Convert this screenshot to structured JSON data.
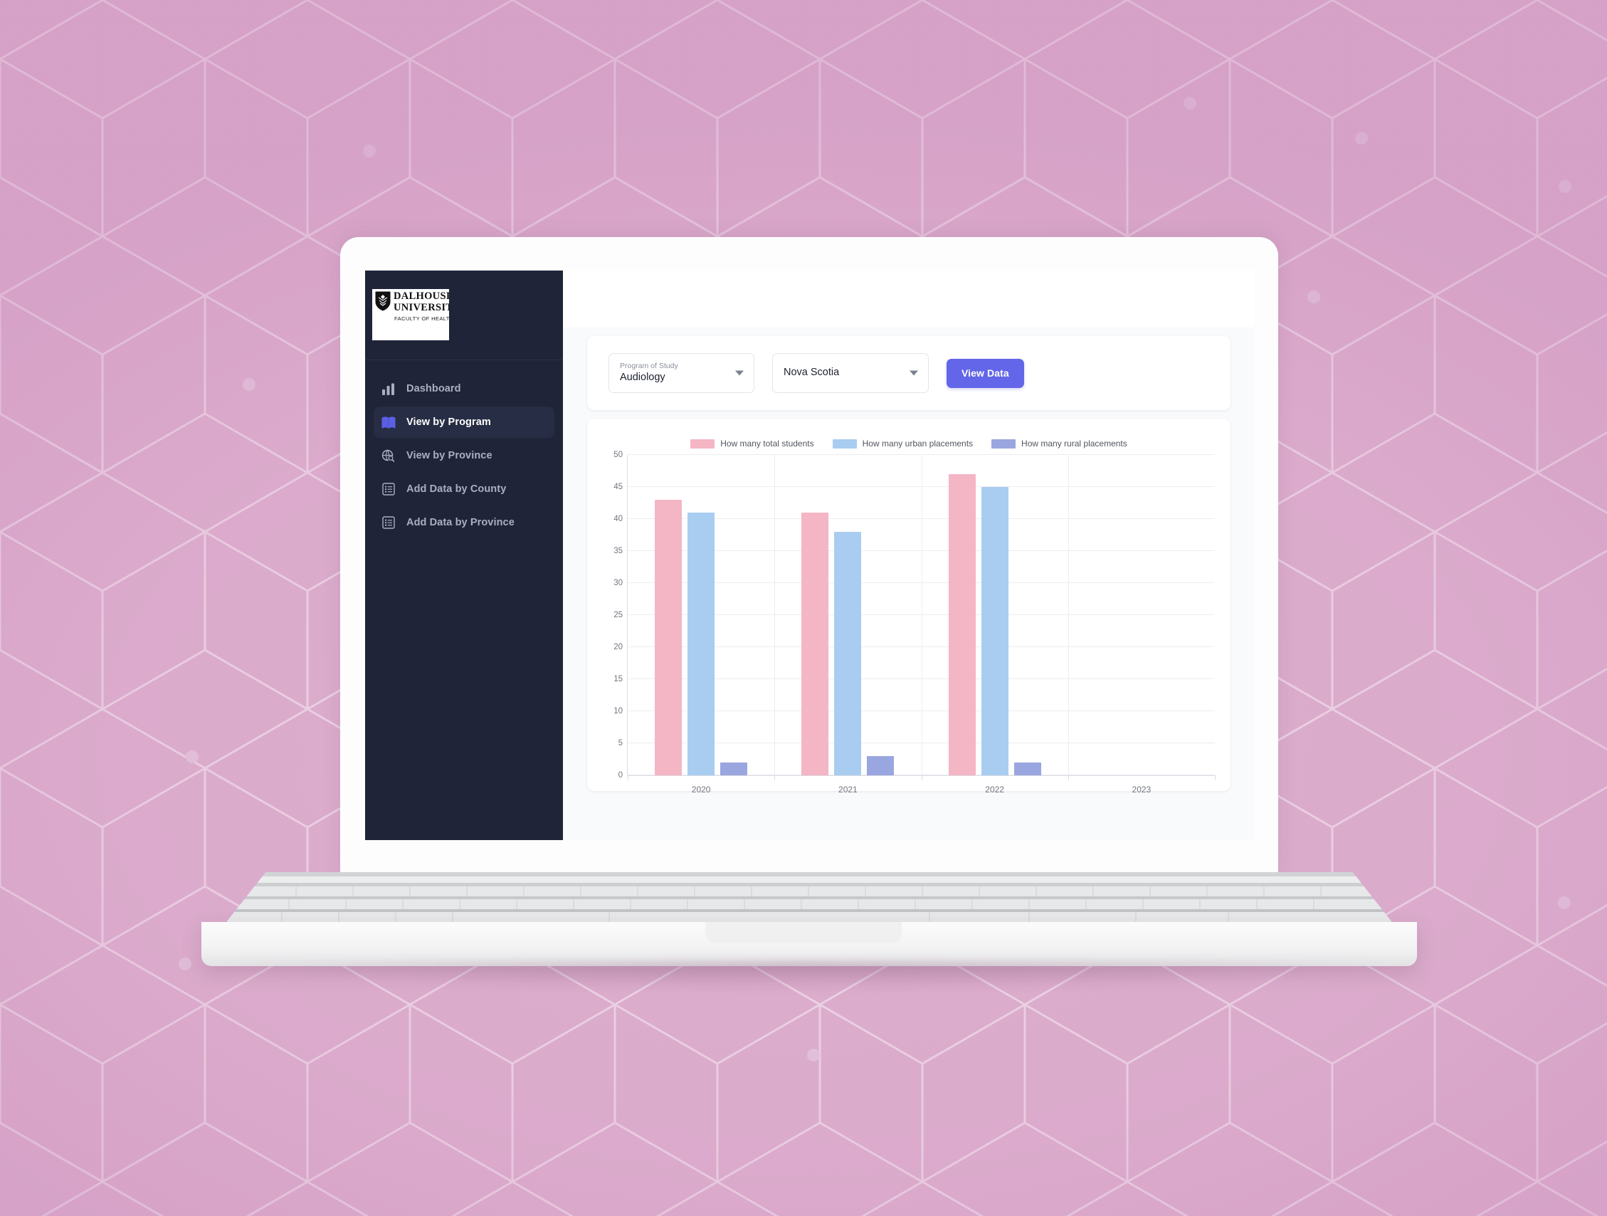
{
  "sidebar": {
    "logo": {
      "line1": "DALHOUSIE",
      "line2": "UNIVERSITY",
      "line3": "FACULTY OF HEALTH",
      "crest_icon": "dalhousie-crest-icon"
    },
    "items": [
      {
        "label": "Dashboard",
        "icon": "bar-chart-icon",
        "active": false
      },
      {
        "label": "View by Program",
        "icon": "open-book-icon",
        "active": true
      },
      {
        "label": "View by Province",
        "icon": "globe-search-icon",
        "active": false
      },
      {
        "label": "Add Data by County",
        "icon": "list-table-icon",
        "active": false
      },
      {
        "label": "Add Data by Province",
        "icon": "list-table-icon",
        "active": false
      }
    ]
  },
  "controls": {
    "program_select": {
      "label": "Program of Study",
      "value": "Audiology",
      "caret_icon": "chevron-down-icon"
    },
    "province_select": {
      "label": "",
      "value": "Nova Scotia",
      "caret_icon": "chevron-down-icon"
    },
    "view_data_button": "View Data"
  },
  "colors": {
    "accent": "#6366e8",
    "sidebar_bg": "#1f2438",
    "page_bg": "#dcaecd",
    "series_total": "#f4b5c5",
    "series_urban": "#a9cdf0",
    "series_rural": "#9aa6df"
  },
  "chart_data": {
    "type": "bar",
    "title": "",
    "xlabel": "",
    "ylabel": "",
    "categories": [
      "2020",
      "2021",
      "2022",
      "2023"
    ],
    "series": [
      {
        "name": "How many total students",
        "color": "#f4b5c5",
        "values": [
          43,
          41,
          47,
          null
        ]
      },
      {
        "name": "How many urban placements",
        "color": "#a9cdf0",
        "values": [
          41,
          38,
          45,
          null
        ]
      },
      {
        "name": "How many rural placements",
        "color": "#9aa6df",
        "values": [
          2,
          3,
          2,
          null
        ]
      }
    ],
    "ylim": [
      0,
      50
    ],
    "yticks": [
      0,
      5,
      10,
      15,
      20,
      25,
      30,
      35,
      40,
      45,
      50
    ],
    "grid": true,
    "legend_position": "top-center"
  }
}
